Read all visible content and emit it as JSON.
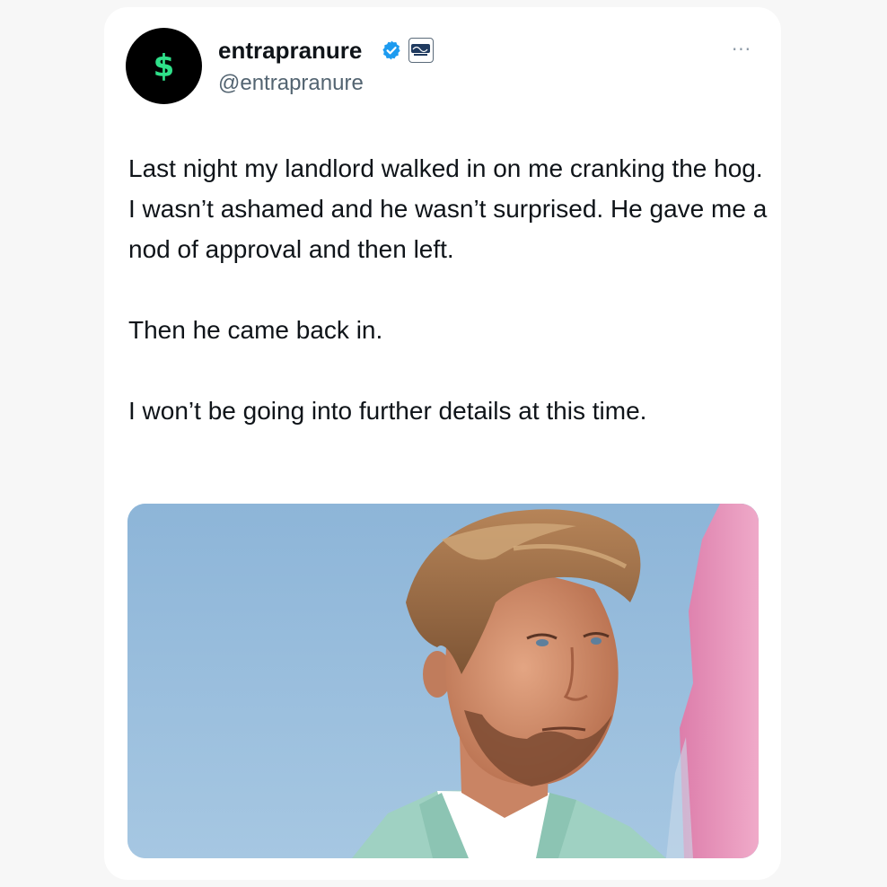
{
  "tweet": {
    "display_name": "entrapranure",
    "handle": "@entrapranure",
    "avatar_symbol": "$",
    "more_label": "···",
    "paragraphs": [
      "Last night my landlord walked in on me cranking the hog. I wasn’t ashamed and he wasn’t surprised. He gave me a nod of approval and then left.",
      "Then he came back in.",
      "I won’t be going into further details at this time."
    ]
  },
  "icons": {
    "verified": "verified-badge-icon",
    "affiliate": "affiliate-badge-icon",
    "more": "more-options-icon"
  },
  "colors": {
    "verified_blue": "#1d9bf0",
    "avatar_bg": "#000000",
    "dollar_green": "#2fe08a",
    "photo_sky": "#9cc1df",
    "photo_pink": "#e98bb5"
  },
  "media": {
    "subject": "photo of man with swept-back blond hair, light beard, mint jacket, against blue sky with pink structure"
  }
}
